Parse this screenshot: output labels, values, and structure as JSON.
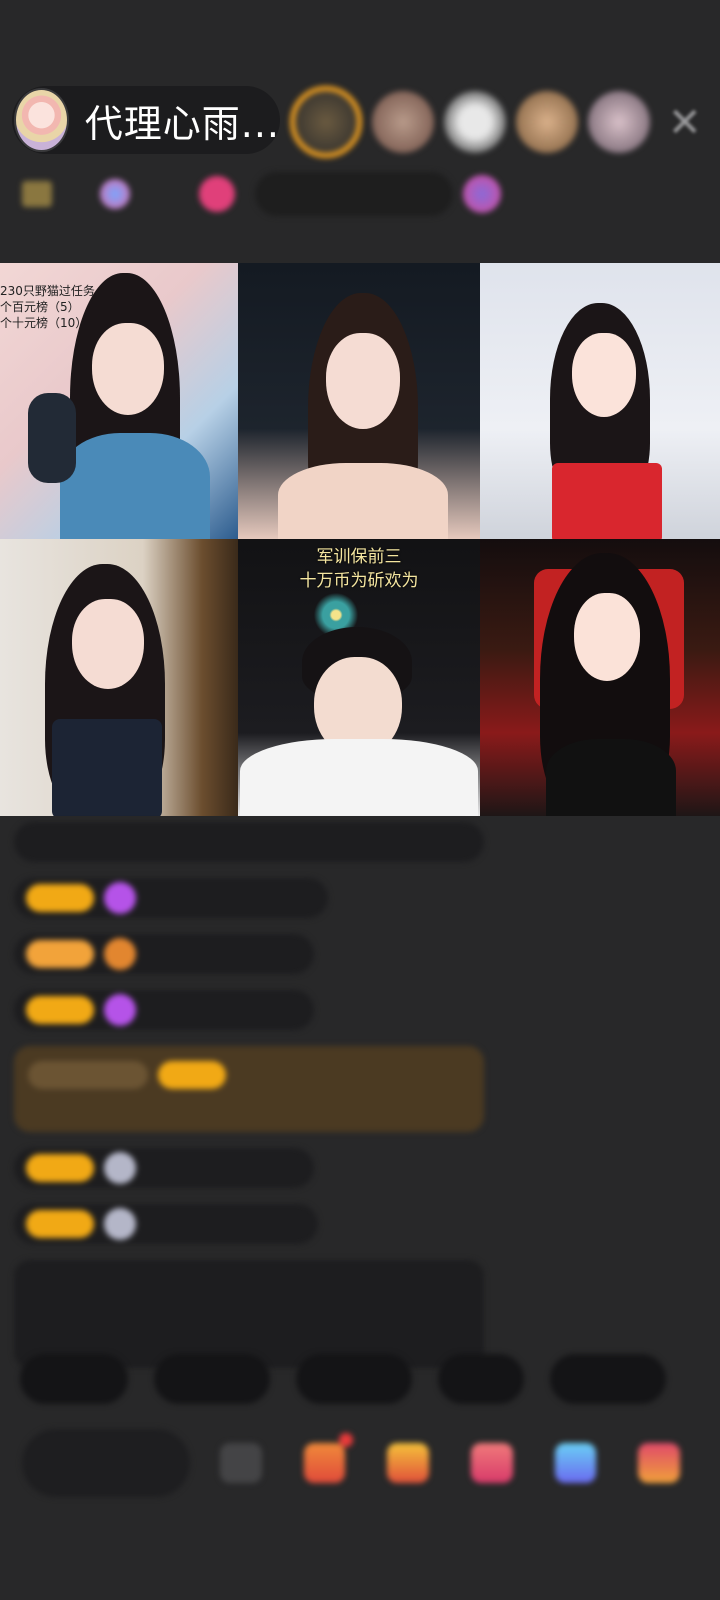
{
  "header": {
    "host_name": "代理心雨...",
    "close_icon": "close-icon",
    "viewer_avatars": [
      "top-viewer-1",
      "viewer-2",
      "viewer-3",
      "viewer-4",
      "viewer-5"
    ]
  },
  "video_grid": {
    "tiles": [
      {
        "overlay_lines": [
          "230只野猫过任务",
          "个百元榜（5）",
          "个十元榜（10）"
        ]
      },
      {
        "overlay_lines": []
      },
      {
        "overlay_lines": []
      },
      {
        "overlay_lines": []
      },
      {
        "caption_lines": [
          "军训保前三",
          "十万币为斫欢为"
        ]
      },
      {
        "overlay_lines": []
      }
    ]
  },
  "colors": {
    "background": "#282829",
    "level_badge": "#f1a915",
    "system_message": "#9bd06b",
    "highlight_message": "#4b3a22"
  }
}
